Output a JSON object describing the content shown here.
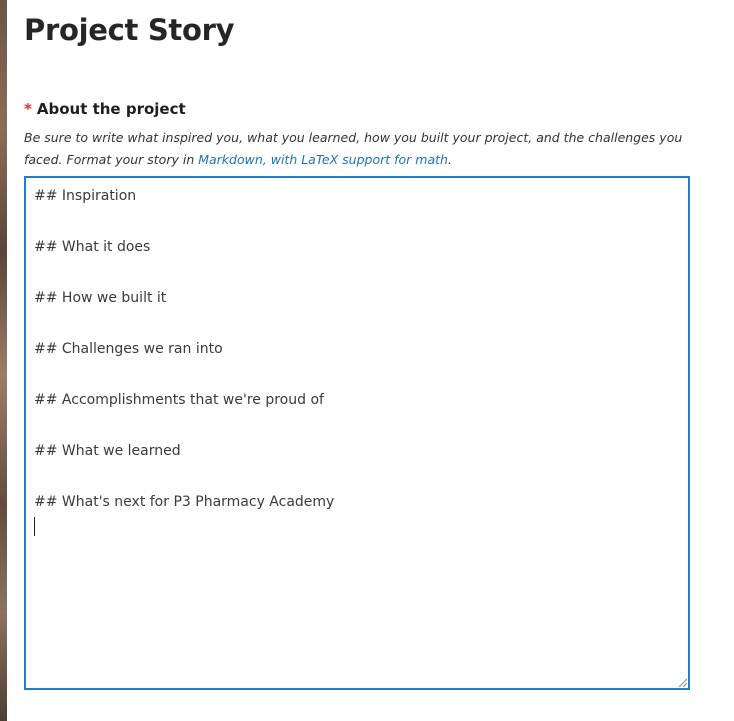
{
  "page": {
    "title": "Project Story"
  },
  "about_field": {
    "required_marker": "*",
    "label": "About the project",
    "help_text_before": "Be sure to write what inspired you, what you learned, how you built your project, and the challenges you faced. Format your story in ",
    "help_link_text": "Markdown, with LaTeX support for math",
    "help_text_after": ".",
    "value_lines": [
      "## Inspiration",
      "## What it does",
      "## How we built it",
      "## Challenges we ran into",
      "## Accomplishments that we're proud of",
      "## What we learned",
      "## What's next for P3 Pharmacy Academy"
    ]
  },
  "colors": {
    "accent_border": "#2b7bbf",
    "link": "#1d72b8",
    "required": "#d9342b"
  }
}
